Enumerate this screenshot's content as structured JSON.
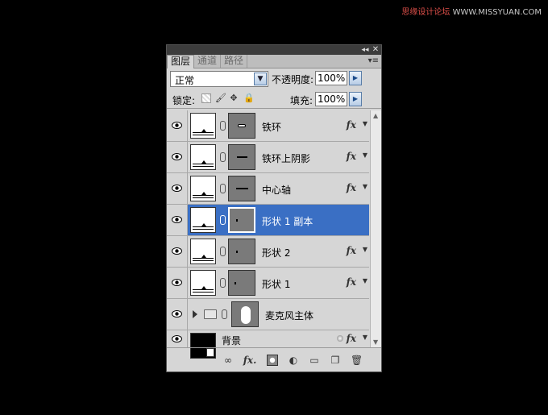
{
  "watermark": {
    "site": "思缘设计论坛",
    "url": "WWW.MISSYUAN.COM"
  },
  "tabs": [
    {
      "label": "图层"
    },
    {
      "label": "通道"
    },
    {
      "label": "路径"
    }
  ],
  "blend": {
    "mode": "正常"
  },
  "opacity": {
    "label": "不透明度:",
    "value": "100%"
  },
  "lock": {
    "label": "锁定:"
  },
  "fill": {
    "label": "填充:",
    "value": "100%"
  },
  "layers": [
    {
      "name": "铁环",
      "fx": "fx"
    },
    {
      "name": "铁环上阴影",
      "fx": "fx"
    },
    {
      "name": "中心轴",
      "fx": "fx"
    },
    {
      "name": "形状 1 副本"
    },
    {
      "name": "形状 2",
      "fx": "fx"
    },
    {
      "name": "形状 1",
      "fx": "fx"
    },
    {
      "name": "麦克风主体"
    },
    {
      "name": "背景",
      "fx": "fx"
    }
  ],
  "selected_layer": "形状 1 副本",
  "colors": {
    "selection": "#3a6fc4",
    "panel": "#d6d6d6",
    "background": "#000000"
  },
  "icons": {
    "footer": [
      "link-layers-icon",
      "fx-icon",
      "add-mask-icon",
      "adjustment-layer-icon",
      "new-group-icon",
      "new-layer-icon",
      "trash-icon"
    ]
  }
}
